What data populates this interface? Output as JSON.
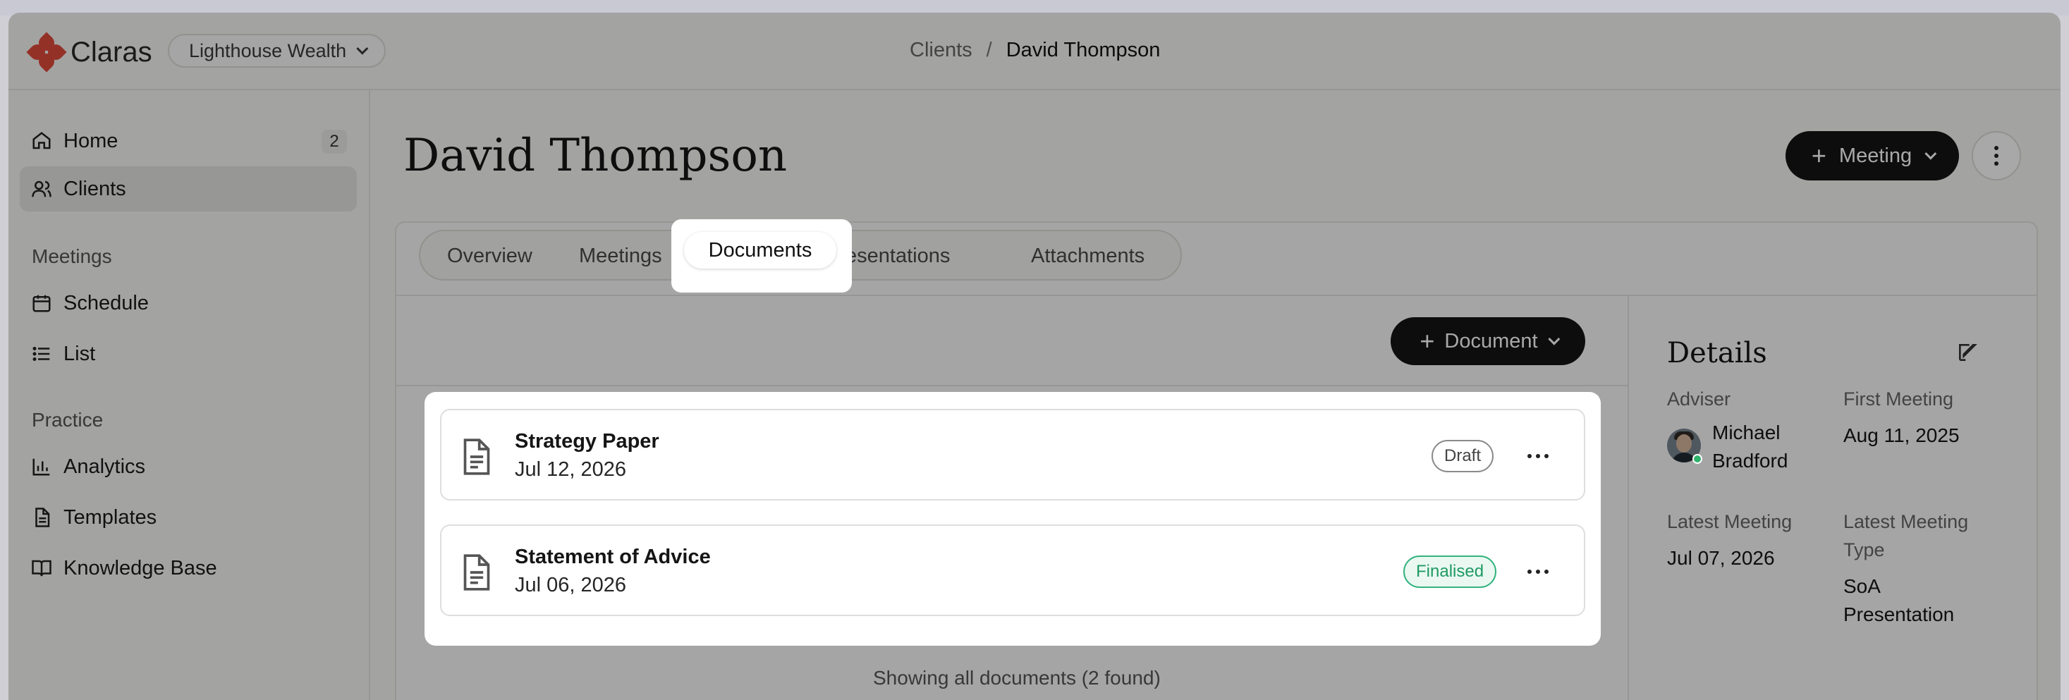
{
  "header": {
    "app_name": "Claras",
    "organization": "Lighthouse Wealth",
    "breadcrumb": {
      "parent": "Clients",
      "separator": "/",
      "current": "David Thompson"
    }
  },
  "sidebar": {
    "items": [
      {
        "label": "Home",
        "icon": "home-icon",
        "badge": "2"
      },
      {
        "label": "Clients",
        "icon": "users-icon",
        "active": true
      }
    ],
    "sections": [
      {
        "title": "Meetings",
        "items": [
          {
            "label": "Schedule",
            "icon": "calendar-icon"
          },
          {
            "label": "List",
            "icon": "list-icon"
          }
        ]
      },
      {
        "title": "Practice",
        "items": [
          {
            "label": "Analytics",
            "icon": "bar-chart-icon"
          },
          {
            "label": "Templates",
            "icon": "document-icon"
          },
          {
            "label": "Knowledge Base",
            "icon": "book-icon"
          }
        ]
      }
    ]
  },
  "main": {
    "title": "David Thompson",
    "meeting_button": "Meeting",
    "tabs": [
      {
        "label": "Overview"
      },
      {
        "label": "Meetings"
      },
      {
        "label": "Documents",
        "active": true
      },
      {
        "label": "Presentations"
      },
      {
        "label": "Attachments"
      }
    ],
    "document_button": "Document",
    "documents": [
      {
        "name": "Strategy Paper",
        "date": "Jul 12, 2026",
        "status": "Draft"
      },
      {
        "name": "Statement of Advice",
        "date": "Jul 06, 2026",
        "status": "Finalised"
      }
    ],
    "footer_note": "Showing all documents (2 found)"
  },
  "details": {
    "title": "Details",
    "adviser_label": "Adviser",
    "adviser_name_line1": "Michael",
    "adviser_name_line2": "Bradford",
    "first_meeting_label": "First Meeting",
    "first_meeting_value": "Aug 11, 2025",
    "latest_meeting_label": "Latest Meeting",
    "latest_meeting_value": "Jul 07, 2026",
    "latest_meeting_type_label_line1": "Latest Meeting",
    "latest_meeting_type_label_line2": "Type",
    "latest_meeting_type_value_line1": "SoA",
    "latest_meeting_type_value_line2": "Presentation"
  },
  "colors": {
    "brand": "#e14b3c",
    "primary_button": "#151515",
    "finalised": "#1f9a64",
    "online": "#2fb36d"
  }
}
